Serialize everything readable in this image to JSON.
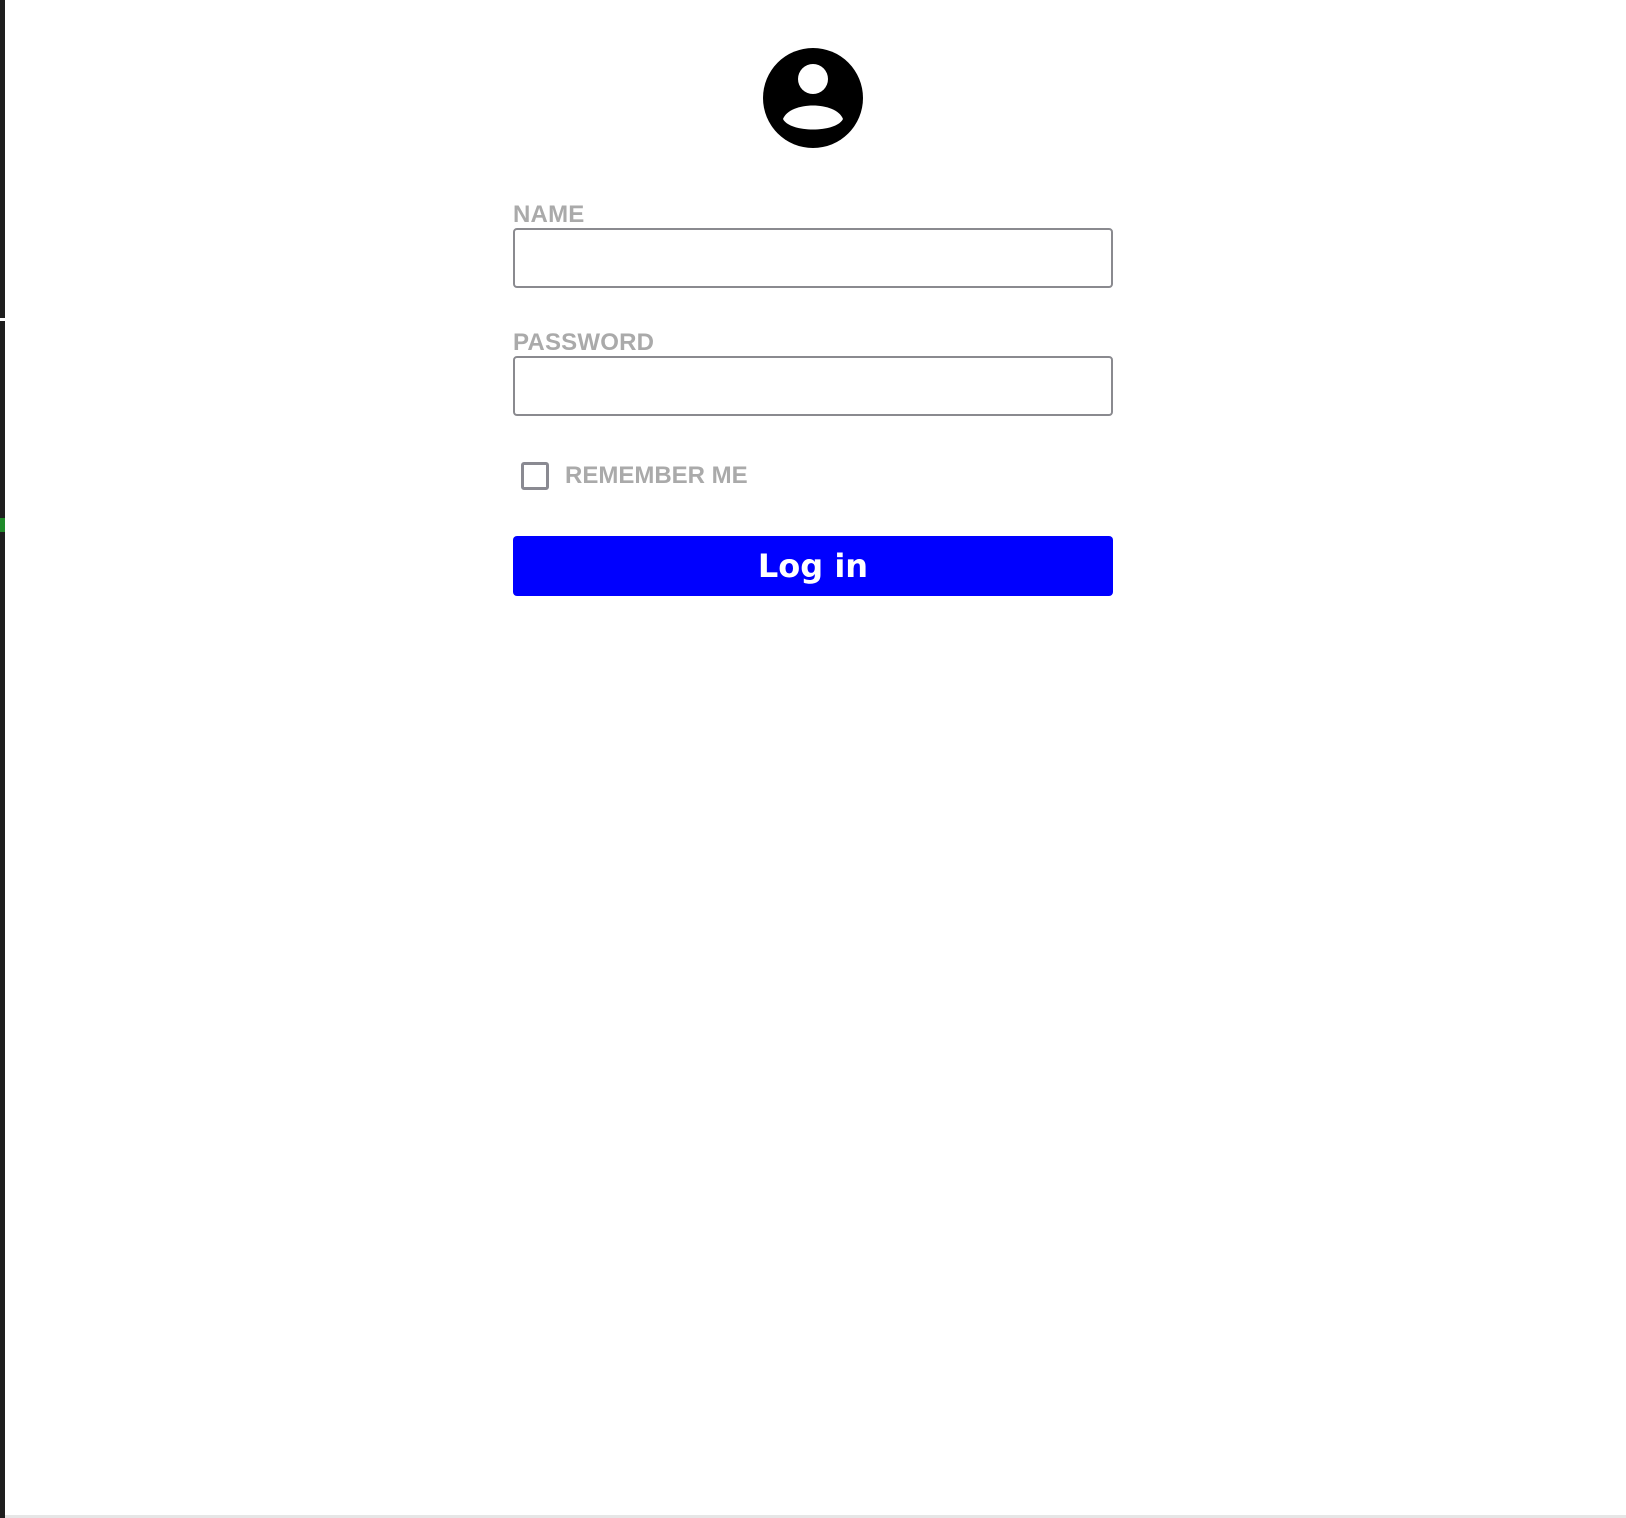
{
  "form": {
    "avatar_icon": "account-circle-icon",
    "name_label": "NAME",
    "name_value": "",
    "password_label": "PASSWORD",
    "password_value": "",
    "remember_label": "REMEMBER ME",
    "remember_checked": false,
    "login_label": "Log in"
  },
  "colors": {
    "button_background": "#0000ff",
    "button_text": "#ffffff",
    "label_text": "#aaaaaa",
    "input_border": "#8a8a8f",
    "avatar": "#000000"
  }
}
